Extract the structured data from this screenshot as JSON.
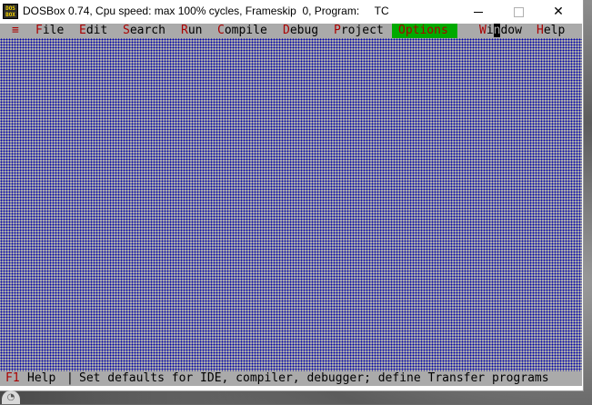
{
  "window": {
    "title": "DOSBox 0.74, Cpu speed: max 100% cycles, Frameskip  0, Program:     TC",
    "icon_text": "DOS\nBOX",
    "min_icon": "minimize-icon",
    "max_icon": "maximize-icon",
    "close_icon": "close-icon",
    "close_glyph": "✕"
  },
  "menubar": {
    "system_glyph": "≡",
    "items": [
      {
        "hot": "F",
        "rest": "ile"
      },
      {
        "hot": "E",
        "rest": "dit"
      },
      {
        "hot": "S",
        "rest": "earch"
      },
      {
        "hot": "R",
        "rest": "un"
      },
      {
        "hot": "C",
        "rest": "ompile"
      },
      {
        "hot": "D",
        "rest": "ebug"
      },
      {
        "hot": "P",
        "rest": "roject"
      },
      {
        "hot": "O",
        "rest": "ptions",
        "active": true
      },
      {
        "hot": "W",
        "pre": "i",
        "cursor": "n",
        "rest": "dow"
      },
      {
        "hot": "H",
        "rest": "elp"
      }
    ]
  },
  "statusbar": {
    "key": "F1",
    "key_label": "Help",
    "separator": "|",
    "message": "Set defaults for IDE, compiler, debugger; define Transfer programs"
  },
  "colors": {
    "menu_bg": "#aaaaaa",
    "hotkey": "#aa0000",
    "active_bg": "#00aa00",
    "desktop_dot": "#0000aa"
  }
}
